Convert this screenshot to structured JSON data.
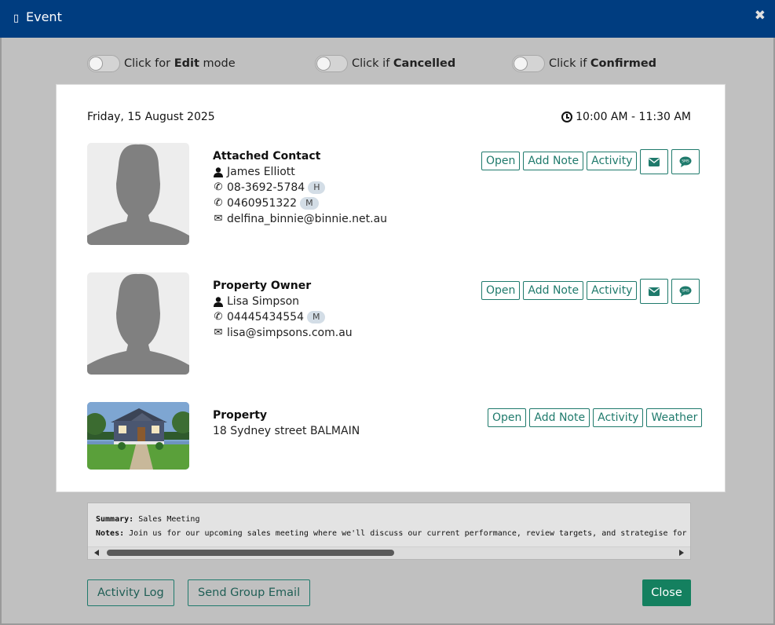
{
  "window": {
    "title": "Event",
    "title_icon": "calendar-icon",
    "close_symbol": "✖"
  },
  "toggles": [
    {
      "prefix": "Click for ",
      "bold": "Edit",
      "suffix": " mode",
      "on": false
    },
    {
      "prefix": "Click if ",
      "bold": "Cancelled",
      "suffix": "",
      "on": false
    },
    {
      "prefix": "Click if ",
      "bold": "Confirmed",
      "suffix": "",
      "on": false
    }
  ],
  "event": {
    "date": "Friday, 15 August 2025",
    "time": "10:00 AM - 11:30 AM"
  },
  "contact": {
    "heading": "Attached Contact",
    "name": "James Elliott",
    "phone1": "08-3692-5784",
    "phone1_badge": "H",
    "phone2": "0460951322",
    "phone2_badge": "M",
    "email": "delfina_binnie@binnie.net.au"
  },
  "owner": {
    "heading": "Property Owner",
    "name": "Lisa Simpson",
    "phone": "04445434554",
    "phone_badge": "M",
    "email": "lisa@simpsons.com.au"
  },
  "property": {
    "heading": "Property",
    "address": "18 Sydney street BALMAIN"
  },
  "buttons": {
    "open": "Open",
    "add_note": "Add Note",
    "activity": "Activity",
    "weather": "Weather",
    "sms": "SMS"
  },
  "notes": {
    "summary_label": "Summary:",
    "summary": "Sales Meeting",
    "notes_label": "Notes:",
    "notes": "Join us for our upcoming sales meeting where we'll discuss our current performance, review targets, and strategise for"
  },
  "footer": {
    "activity_log": "Activity Log",
    "group_email": "Send Group Email",
    "close": "Close"
  },
  "colors": {
    "titlebar": "#003d80",
    "accent": "#1f7a6c",
    "close_button": "#14805f",
    "overlay": "#c0c0c0"
  }
}
